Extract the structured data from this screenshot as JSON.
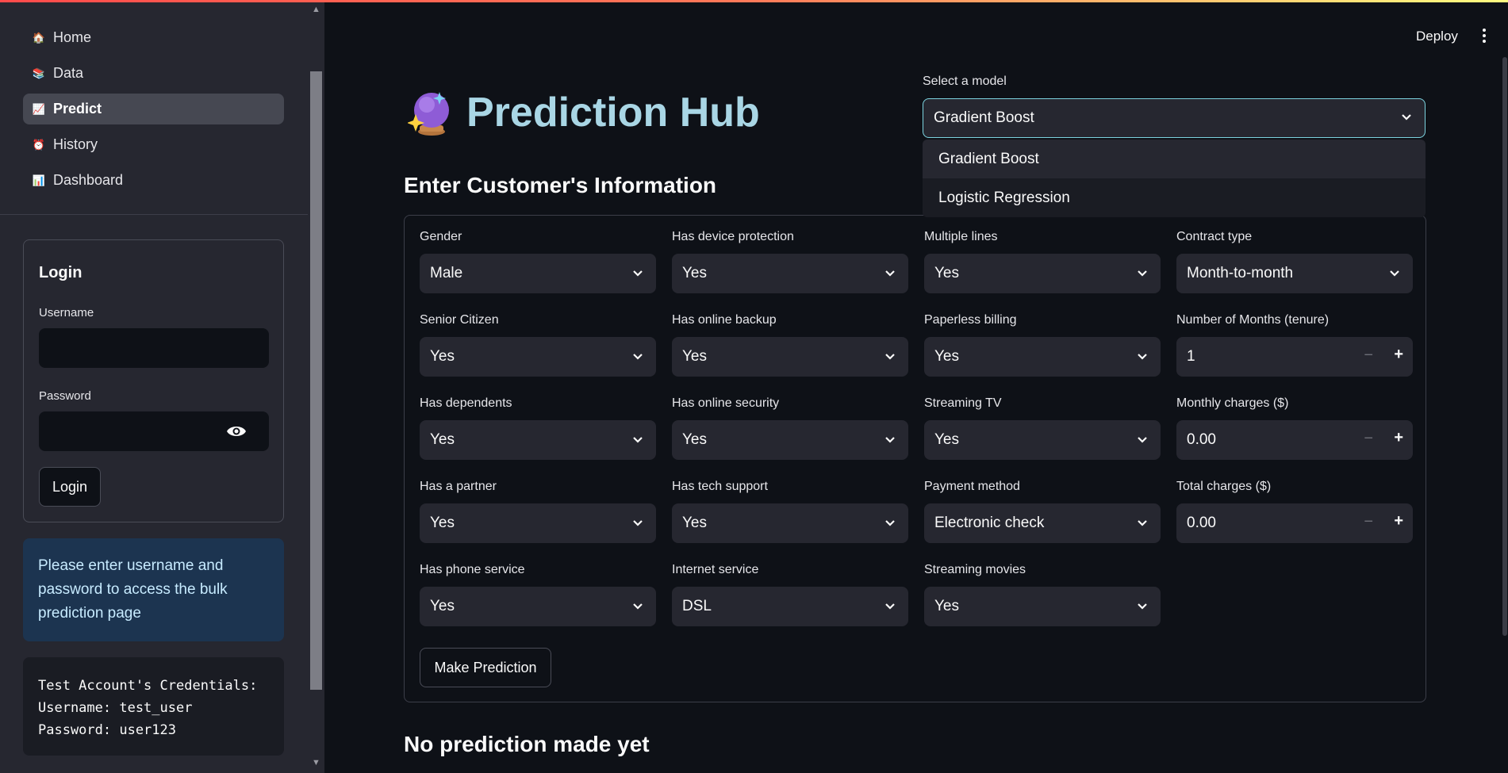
{
  "sidebar": {
    "nav": [
      {
        "label": "Home",
        "icon": "house-icon",
        "glyph": "🏠"
      },
      {
        "label": "Data",
        "icon": "books-icon",
        "glyph": "📚"
      },
      {
        "label": "Predict",
        "icon": "chart-increasing-icon",
        "glyph": "📈",
        "active": true
      },
      {
        "label": "History",
        "icon": "alarm-clock-icon",
        "glyph": "⏰"
      },
      {
        "label": "Dashboard",
        "icon": "bar-chart-icon",
        "glyph": "📊"
      }
    ],
    "login": {
      "title": "Login",
      "username_label": "Username",
      "username_value": "",
      "password_label": "Password",
      "password_value": "",
      "button": "Login"
    },
    "info": "Please enter username and password to access the bulk prediction page",
    "credentials": "Test Account's Credentials:\nUsername: test_user\nPassword: user123"
  },
  "header": {
    "deploy": "Deploy"
  },
  "main": {
    "title": "Prediction Hub",
    "section_title": "Enter Customer's Information",
    "model": {
      "label": "Select a model",
      "selected": "Gradient Boost",
      "options": [
        "Gradient Boost",
        "Logistic Regression"
      ]
    },
    "form": {
      "columns": [
        [
          {
            "label": "Gender",
            "value": "Male"
          },
          {
            "label": "Senior Citizen",
            "value": "Yes"
          },
          {
            "label": "Has dependents",
            "value": "Yes"
          },
          {
            "label": "Has a partner",
            "value": "Yes"
          },
          {
            "label": "Has phone service",
            "value": "Yes"
          }
        ],
        [
          {
            "label": "Has device protection",
            "value": "Yes"
          },
          {
            "label": "Has online backup",
            "value": "Yes"
          },
          {
            "label": "Has online security",
            "value": "Yes"
          },
          {
            "label": "Has tech support",
            "value": "Yes"
          },
          {
            "label": "Internet service",
            "value": "DSL"
          }
        ],
        [
          {
            "label": "Multiple lines",
            "value": "Yes"
          },
          {
            "label": "Paperless billing",
            "value": "Yes"
          },
          {
            "label": "Streaming TV",
            "value": "Yes"
          },
          {
            "label": "Payment method",
            "value": "Electronic check"
          },
          {
            "label": "Streaming movies",
            "value": "Yes"
          }
        ],
        [
          {
            "label": "Contract type",
            "value": "Month-to-month",
            "kind": "select"
          },
          {
            "label": "Number of Months (tenure)",
            "value": "1",
            "kind": "number"
          },
          {
            "label": "Monthly charges ($)",
            "value": "0.00",
            "kind": "number"
          },
          {
            "label": "Total charges ($)",
            "value": "0.00",
            "kind": "number"
          }
        ]
      ],
      "submit": "Make Prediction"
    },
    "result": "No prediction made yet"
  }
}
